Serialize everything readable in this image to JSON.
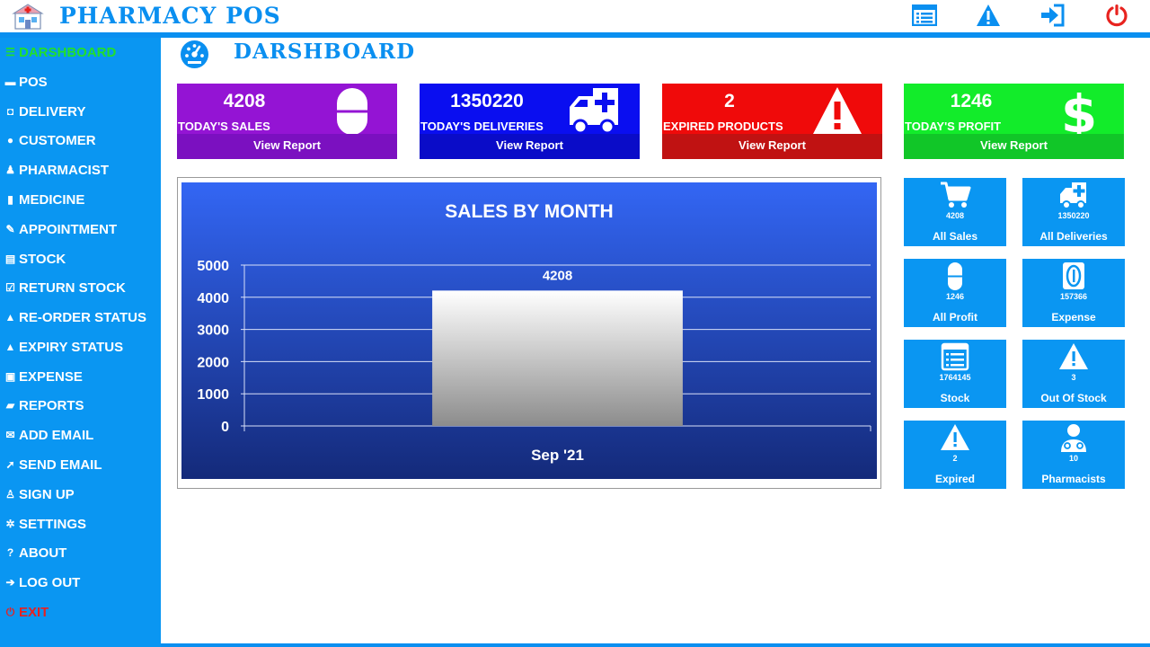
{
  "app": {
    "title": "PHARMACY POS"
  },
  "topbar": {
    "icons": [
      "list-icon",
      "warning-icon",
      "sign-in-icon",
      "power-icon"
    ],
    "colors": {
      "accent": "#0a8ff0",
      "power": "#e8231f"
    }
  },
  "sidebar": {
    "items": [
      {
        "label": "DARSHBOARD",
        "icon": "dashboard-icon",
        "active": true
      },
      {
        "label": "POS",
        "icon": "cart-icon"
      },
      {
        "label": "DELIVERY",
        "icon": "truck-icon"
      },
      {
        "label": "CUSTOMER",
        "icon": "users-icon"
      },
      {
        "label": "PHARMACIST",
        "icon": "user-md-icon"
      },
      {
        "label": "MEDICINE",
        "icon": "pill-icon"
      },
      {
        "label": "APPOINTMENT",
        "icon": "pencil-icon"
      },
      {
        "label": "STOCK",
        "icon": "list-icon"
      },
      {
        "label": "RETURN STOCK",
        "icon": "edit-icon"
      },
      {
        "label": "RE-ORDER STATUS",
        "icon": "warning-icon"
      },
      {
        "label": "EXPIRY STATUS",
        "icon": "warning-icon"
      },
      {
        "label": "EXPENSE",
        "icon": "money-icon"
      },
      {
        "label": "REPORTS",
        "icon": "book-icon"
      },
      {
        "label": "ADD EMAIL",
        "icon": "envelope-icon"
      },
      {
        "label": "SEND EMAIL",
        "icon": "paper-plane-icon"
      },
      {
        "label": "SIGN UP",
        "icon": "user-plus-icon"
      },
      {
        "label": "SETTINGS",
        "icon": "gears-icon"
      },
      {
        "label": "ABOUT",
        "icon": "question-icon"
      },
      {
        "label": "LOG OUT",
        "icon": "sign-in-icon"
      },
      {
        "label": "EXIT",
        "icon": "power-icon"
      }
    ]
  },
  "page": {
    "title": "DARSHBOARD",
    "icon": "dashboard-icon"
  },
  "cards": [
    {
      "value": "4208",
      "label": "TODAY'S SALES",
      "link": "View Report",
      "icon": "pill-icon",
      "color": "#9414d4",
      "foot_color": "#7b10c0"
    },
    {
      "value": "1350220",
      "label": "TODAY'S DELIVERIES",
      "link": "View Report",
      "icon": "ambulance-icon",
      "color": "#0a0ef0",
      "foot_color": "#0a0cc8"
    },
    {
      "value": "2",
      "label": "EXPIRED PRODUCTS",
      "link": "View Report",
      "icon": "warning-icon",
      "color": "#f00a0a",
      "foot_color": "#c01212"
    },
    {
      "value": "1246",
      "label": "TODAY'S PROFIT",
      "link": "View Report",
      "icon": "dollar-icon",
      "color": "#12ec2a",
      "foot_color": "#11c628"
    }
  ],
  "tiles": [
    {
      "value": "4208",
      "label": "All Sales",
      "icon": "cart-icon"
    },
    {
      "value": "1350220",
      "label": "All Deliveries",
      "icon": "ambulance-icon"
    },
    {
      "value": "1246",
      "label": "All Profit",
      "icon": "pill-icon"
    },
    {
      "value": "157366",
      "label": "Expense",
      "icon": "money-icon"
    },
    {
      "value": "1764145",
      "label": "Stock",
      "icon": "list-icon"
    },
    {
      "value": "3",
      "label": "Out Of Stock",
      "icon": "warning-icon"
    },
    {
      "value": "2",
      "label": "Expired",
      "icon": "warning-icon"
    },
    {
      "value": "10",
      "label": "Pharmacists",
      "icon": "user-md-icon"
    }
  ],
  "chart_data": {
    "type": "bar",
    "title": "SALES BY MONTH",
    "categories": [
      "Sep '21"
    ],
    "values": [
      4208
    ],
    "data_labels": [
      "4208"
    ],
    "ylim": [
      0,
      5000
    ],
    "yticks": [
      "0",
      "1000",
      "2000",
      "3000",
      "4000",
      "5000"
    ],
    "grid": true,
    "legend": "none",
    "xlabel": "",
    "ylabel": ""
  }
}
